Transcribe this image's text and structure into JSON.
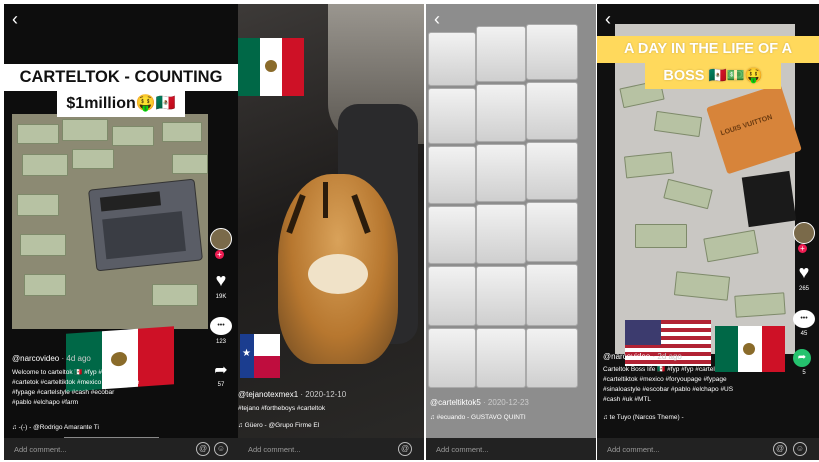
{
  "colors": {
    "tiktok_red": "#ee1d52",
    "caption_yellow": "#ffd95c",
    "bar_bg": "#222222",
    "mx_green": "#006847",
    "mx_red": "#ce1126"
  },
  "common": {
    "back_glyph": "‹",
    "comment_placeholder": "Add comment...",
    "at_glyph": "@",
    "emoji_glyph": "☺",
    "heart_glyph": "♥",
    "chat_glyph": "•••",
    "share_glyph": "➦",
    "music_glyph": "♫"
  },
  "panel1": {
    "caption_line1": "CARTELTOK - COUNTING",
    "caption_line2": "$1million🤑🇲🇽",
    "username": "@narcovideo",
    "date": "· 4d ago",
    "description": [
      "Welcome to carteltok 🇲🇽 #fyp #fyp #cartel",
      "#cartetok #carteltiktok #mexico #foryoupage",
      "#fypage #cartelstyle #cash #ecobar",
      "#pablo #elchapo #farm"
    ],
    "music": "♫ -(-) - @Rodrigo Amarante    Ti",
    "like_count": "19K",
    "comment_count": "123",
    "share_count": "57"
  },
  "panel2": {
    "username": "@tejanotexmex1",
    "date": "· 2020-12-10",
    "description": [
      "#tejano #fortheboys #carteltok"
    ],
    "music": "♫ Güero - @Grupo Firme   El"
  },
  "panel3": {
    "username": "@carteltiktok5",
    "date": "· 2020-12-23",
    "music": "♫ #ecuando - GUSTAVO QUINTI"
  },
  "panel4": {
    "caption_line1": "A DAY IN THE LIFE OF A",
    "caption_line2": "BOSS 🇲🇽💵🤑",
    "bag_text": "LOUIS VUITTON",
    "username": "@narcovideo",
    "date": "· 2d ago",
    "description": [
      "Carteltok Boss life 🇲🇽 #fyp #fyp #cartel",
      "#carteltiktok #mexico #foryoupage #fypage",
      "#sinaloastyle #escobar #pablo #elchapo #US",
      "#cash #uk #MTL"
    ],
    "music": "♫ te    Tuyo (Narcos Theme) -",
    "like_count": "265",
    "comment_count": "45",
    "share_count": "5"
  }
}
